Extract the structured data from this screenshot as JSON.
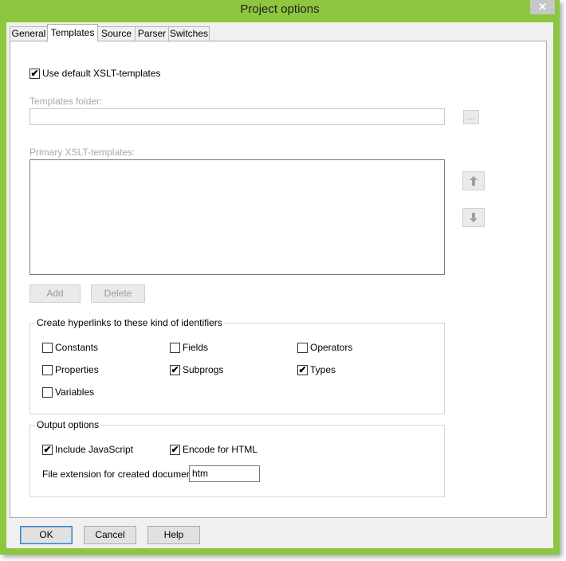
{
  "window": {
    "title": "Project options",
    "close": "✕"
  },
  "tabs": [
    {
      "label": "General"
    },
    {
      "label": "Templates"
    },
    {
      "label": "Source"
    },
    {
      "label": "Parser"
    },
    {
      "label": "Switches"
    }
  ],
  "templates": {
    "use_default_label": "Use default XSLT-templates",
    "use_default_checked": true,
    "folder_label": "Templates folder:",
    "folder_value": "",
    "browse_label": "...",
    "primary_label": "Primary XSLT-templates:",
    "primary_items": [],
    "add_label": "Add",
    "delete_label": "Delete"
  },
  "hyperlinks": {
    "title": "Create hyperlinks to these kind of identifiers",
    "items": [
      {
        "label": "Constants",
        "checked": false
      },
      {
        "label": "Fields",
        "checked": false
      },
      {
        "label": "Operators",
        "checked": false
      },
      {
        "label": "Properties",
        "checked": false
      },
      {
        "label": "Subprogs",
        "checked": true
      },
      {
        "label": "Types",
        "checked": true
      },
      {
        "label": "Variables",
        "checked": false
      }
    ]
  },
  "output": {
    "title": "Output options",
    "include_js_label": "Include JavaScript",
    "include_js_checked": true,
    "encode_html_label": "Encode for HTML",
    "encode_html_checked": true,
    "ext_label": "File extension for created documents:",
    "ext_value": "htm"
  },
  "footer": {
    "ok": "OK",
    "cancel": "Cancel",
    "help": "Help"
  },
  "icons": {
    "up": "arrow-up-icon",
    "down": "arrow-down-icon"
  }
}
